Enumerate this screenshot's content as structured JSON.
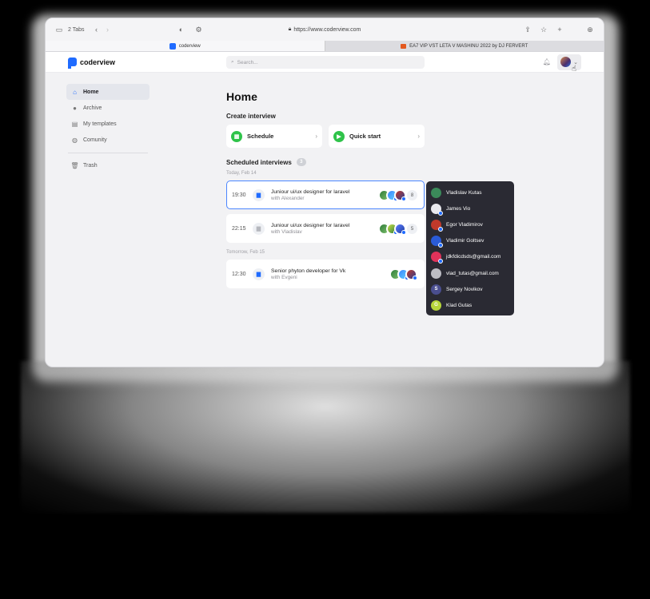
{
  "browser": {
    "tabs_label": "2 Tabs",
    "url": "https://www.coderview.com",
    "tabs": [
      {
        "title": "coderview"
      },
      {
        "title": "EA7 VIP VST LETA V MASHINU 2022 by DJ FERVERT"
      }
    ]
  },
  "app": {
    "logo_text": "coderview",
    "search_placeholder": "Search..."
  },
  "sidebar": {
    "items": [
      {
        "label": "Home",
        "icon": "home-icon"
      },
      {
        "label": "Archive",
        "icon": "archive-icon"
      },
      {
        "label": "My templates",
        "icon": "template-icon"
      },
      {
        "label": "Comunity",
        "icon": "globe-icon"
      },
      {
        "label": "Trash",
        "icon": "trash-icon"
      }
    ]
  },
  "main": {
    "title": "Home",
    "create_title": "Create interview",
    "create_cards": [
      {
        "label": "Schedule",
        "icon": "calendar-icon"
      },
      {
        "label": "Quick start",
        "icon": "video-icon"
      }
    ],
    "scheduled_title": "Scheduled interviews",
    "scheduled_count": "3",
    "groups": [
      {
        "day": "Today, Feb 14",
        "rows": [
          {
            "time": "19:30",
            "title": "Juniour ui/ux designer for laravel",
            "with": "with Alexander",
            "more": "8"
          },
          {
            "time": "22:15",
            "title": "Juniour ui/ux designer for laravel",
            "with": "with Vladislav",
            "more": "5"
          }
        ]
      },
      {
        "day": "Tomorrow, Feb 15",
        "rows": [
          {
            "time": "12:30",
            "title": "Senior phyton developer for Vk",
            "with": "with Evgeni"
          }
        ]
      }
    ]
  },
  "participants_popup": [
    {
      "name": "Vladislav Kutas",
      "color": "#3b8a5a"
    },
    {
      "name": "James Vio",
      "color": "#e9e9ee"
    },
    {
      "name": "Egor Vladimirov",
      "color": "#c0392b"
    },
    {
      "name": "Vladimir Goltsev",
      "color": "#2a5bd7"
    },
    {
      "name": "jdkfdicdsds@gmail.com",
      "color": "#e0325a"
    },
    {
      "name": "vlad_tutas@gmail.com",
      "color": "#bdbdc4"
    },
    {
      "name": "Sergey Novikov",
      "color": "#4a4e8f",
      "initial": "S"
    },
    {
      "name": "Klad Gutas",
      "color": "#b7d63a",
      "initial": "G"
    }
  ]
}
